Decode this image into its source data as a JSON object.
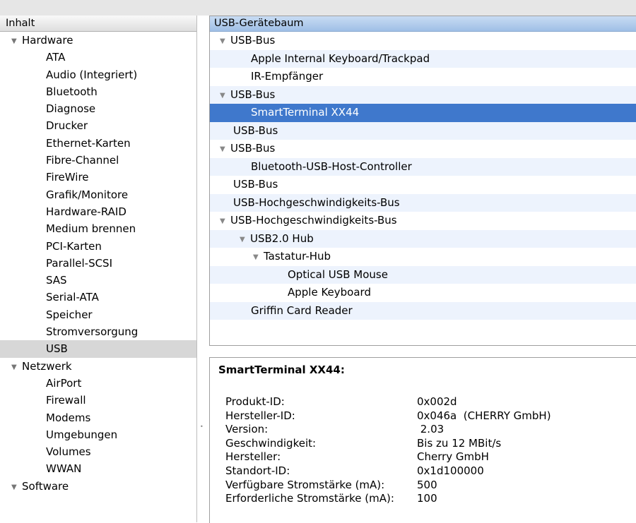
{
  "sidebar": {
    "header": "Inhalt",
    "hardware": {
      "label": "Hardware",
      "items": [
        "ATA",
        "Audio (Integriert)",
        "Bluetooth",
        "Diagnose",
        "Drucker",
        "Ethernet-Karten",
        "Fibre-Channel",
        "FireWire",
        "Grafik/Monitore",
        "Hardware-RAID",
        "Medium brennen",
        "PCI-Karten",
        "Parallel-SCSI",
        "SAS",
        "Serial-ATA",
        "Speicher",
        "Stromversorgung",
        "USB"
      ]
    },
    "netzwerk": {
      "label": "Netzwerk",
      "items": [
        "AirPort",
        "Firewall",
        "Modems",
        "Umgebungen",
        "Volumes",
        "WWAN"
      ]
    },
    "software": {
      "label": "Software"
    },
    "selected": "USB"
  },
  "tree": {
    "header": "USB-Gerätebaum",
    "rows": [
      "USB-Bus",
      "Apple Internal Keyboard/Trackpad",
      "IR-Empfänger",
      "USB-Bus",
      "SmartTerminal XX44",
      "USB-Bus",
      "USB-Bus",
      "Bluetooth-USB-Host-Controller",
      "USB-Bus",
      "USB-Hochgeschwindigkeits-Bus",
      "USB-Hochgeschwindigkeits-Bus",
      "USB2.0 Hub",
      "Tastatur-Hub",
      "Optical USB Mouse",
      "Apple Keyboard",
      "Griffin Card Reader"
    ],
    "selected": "SmartTerminal XX44"
  },
  "detail": {
    "title": "SmartTerminal XX44:",
    "properties": [
      {
        "key": "Produkt-ID:",
        "value": "0x002d"
      },
      {
        "key": "Hersteller-ID:",
        "value": "0x046a  (CHERRY GmbH)"
      },
      {
        "key": "Version:",
        "value": " 2.03"
      },
      {
        "key": "Geschwindigkeit:",
        "value": "Bis zu 12 MBit/s"
      },
      {
        "key": "Hersteller:",
        "value": "Cherry GmbH"
      },
      {
        "key": "Standort-ID:",
        "value": "0x1d100000"
      },
      {
        "key": "Verfügbare Stromstärke (mA):",
        "value": "500"
      },
      {
        "key": "Erforderliche Stromstärke (mA):",
        "value": "100"
      }
    ]
  },
  "icons": {
    "disclosure_open": "disclosure-triangle-down-icon",
    "resize": "splitter-handle-icon"
  },
  "colors": {
    "selection_blue": "#3f78cc",
    "header_blue": "#b5cfee",
    "alt_row": "#edf3fd",
    "sidebar_selection": "#d7d7d7"
  }
}
